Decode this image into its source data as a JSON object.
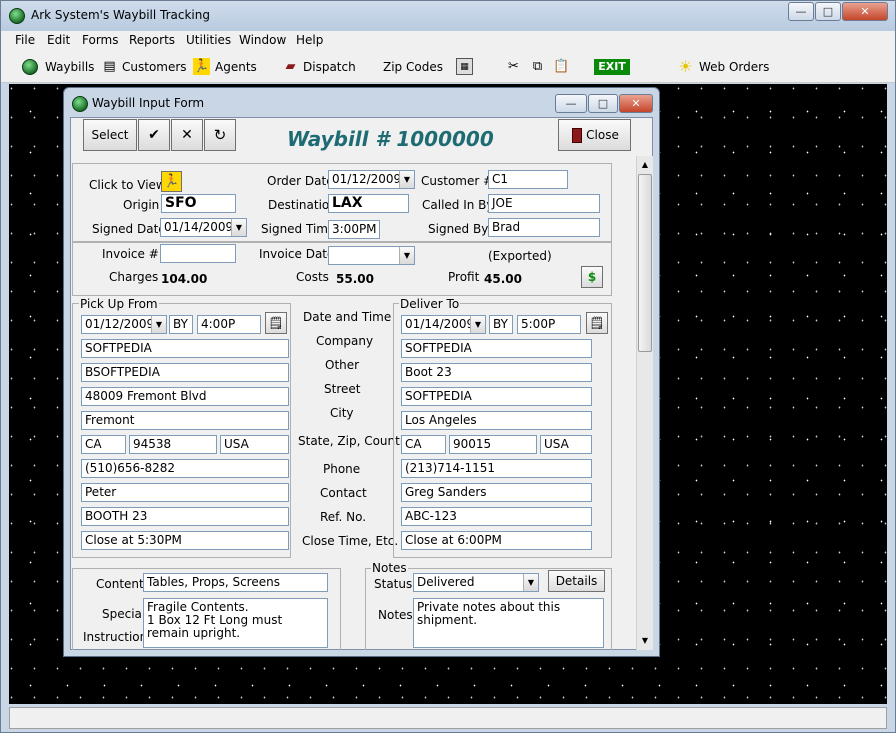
{
  "app": {
    "title": "Ark System's Waybill Tracking"
  },
  "menu": [
    "File",
    "Edit",
    "Forms",
    "Reports",
    "Utilities",
    "Window",
    "Help"
  ],
  "toolbar": {
    "waybills": "Waybills",
    "customers": "Customers",
    "agents": "Agents",
    "dispatch": "Dispatch",
    "zip_codes": "Zip Codes",
    "exit": "EXIT",
    "web_orders": "Web Orders"
  },
  "caption": {
    "min": "—",
    "max": "□",
    "close": "✕"
  },
  "window": {
    "title": "Waybill Input Form"
  },
  "form": {
    "select": "Select",
    "check": "✔",
    "x": "✕",
    "refresh": "↻",
    "heading": "Waybill # 1000000",
    "close_label": "Close",
    "click_to_view": "Click to View",
    "order_date_label": "Order Date",
    "order_date": "01/12/2009",
    "customer_label": "Customer #",
    "customer": "C1",
    "origin_label": "Origin",
    "origin": "SFO",
    "destination_label": "Destination",
    "destination": "LAX",
    "called_in_by_label": "Called In By",
    "called_in_by": "JOE",
    "signed_date_label": "Signed Date",
    "signed_date": "01/14/2009",
    "signed_time_label": "Signed Time",
    "signed_time": "3:00PM",
    "signed_by_label": "Signed By",
    "signed_by": "Brad",
    "invoice_label": "Invoice #",
    "invoice": "",
    "invoice_date_label": "Invoice Date",
    "invoice_date": "",
    "exported": "(Exported)",
    "charges_label": "Charges",
    "charges": "104.00",
    "costs_label": "Costs",
    "costs": "55.00",
    "profit_label": "Profit",
    "profit": "45.00",
    "dollar": "$",
    "pickup": {
      "title": "Pick Up From",
      "date": "01/12/2009",
      "by": "BY",
      "time": "4:00P",
      "company": "SOFTPEDIA",
      "other": "BSOFTPEDIA",
      "street": "48009 Fremont Blvd",
      "city": "Fremont",
      "state": "CA",
      "zip": "94538",
      "country": "USA",
      "phone": "(510)656-8282",
      "contact": "Peter",
      "ref": "BOOTH 23",
      "close_time": "Close at 5:30PM"
    },
    "deliver": {
      "title": "Deliver To",
      "date": "01/14/2009",
      "by": "BY",
      "time": "5:00P",
      "company": "SOFTPEDIA",
      "other": "Boot 23",
      "street": "SOFTPEDIA",
      "city": "Los Angeles",
      "state": "CA",
      "zip": "90015",
      "country": "USA",
      "phone": "(213)714-1151",
      "contact": "Greg Sanders",
      "ref": "ABC-123",
      "close_time": "Close at 6:00PM"
    },
    "row_labels": {
      "date_time": "Date and Time",
      "company": "Company",
      "other": "Other",
      "street": "Street",
      "city": "City",
      "state_zip_country": "State, Zip, Country",
      "phone": "Phone",
      "contact": "Contact",
      "ref": "Ref. No.",
      "close_time": "Close Time, Etc."
    },
    "contents_label": "Contents",
    "contents": "Tables, Props, Screens",
    "special_label": "Special",
    "instructions_label": "Instructions",
    "special_line1": "Fragile Contents.",
    "special_line2": "1 Box 12 Ft Long must remain upright.",
    "notes_group": "Notes",
    "status_label": "Status",
    "status": "Delivered",
    "details": "Details",
    "notes_label": "Notes",
    "notes": "Private notes about this shipment."
  },
  "colors": {
    "heading": "#1e6b73",
    "desktop": "#000000",
    "exit": "#0a8a0a"
  }
}
